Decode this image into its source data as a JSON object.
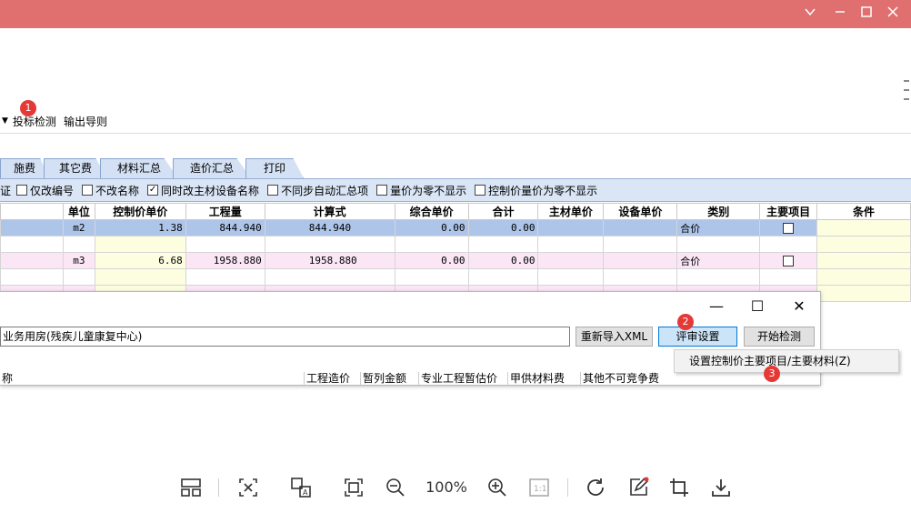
{
  "window": {
    "accent": "#e07070"
  },
  "menu": {
    "items": [
      "投标检测",
      "输出导则"
    ]
  },
  "badges": [
    "1",
    "2",
    "3"
  ],
  "tabs": [
    "施费",
    "其它费",
    "材料汇总",
    "造价汇总",
    "打印"
  ],
  "options": {
    "lead": "证",
    "items": [
      {
        "label": "仅改编号",
        "checked": false
      },
      {
        "label": "不改名称",
        "checked": false
      },
      {
        "label": "同时改主材设备名称",
        "checked": true
      },
      {
        "label": "不同步自动汇总项",
        "checked": false
      },
      {
        "label": "量价为零不显示",
        "checked": false
      },
      {
        "label": "控制价量价为零不显示",
        "checked": false
      }
    ]
  },
  "table": {
    "columns": [
      "",
      "单位",
      "控制价单价",
      "工程量",
      "计算式",
      "综合单价",
      "合计",
      "主材单价",
      "设备单价",
      "类别",
      "主要项目",
      "条件"
    ],
    "rows": [
      {
        "unit": "m2",
        "ctrl_price": "1.38",
        "qty": "844.940",
        "formula": "844.940",
        "unit_price": "0.00",
        "total": "0.00",
        "category": "合价"
      },
      {
        "unit": "m3",
        "ctrl_price": "6.68",
        "qty": "1958.880",
        "formula": "1958.880",
        "unit_price": "0.00",
        "total": "0.00",
        "category": "合价"
      }
    ]
  },
  "dialog": {
    "controls": [
      "—",
      "☐",
      "✕"
    ],
    "project_name": "业务用房(残疾儿童康复中心)",
    "buttons": {
      "reimport": "重新导入XML",
      "review": "评审设置",
      "start": "开始检测"
    },
    "headers": [
      "称",
      "工程造价",
      "暂列金额",
      "专业工程暂估价",
      "甲供材料费",
      "其他不可竞争费"
    ]
  },
  "context_menu": {
    "item": "设置控制价主要项目/主要材料(Z)"
  },
  "viewer": {
    "zoom": "100%"
  }
}
